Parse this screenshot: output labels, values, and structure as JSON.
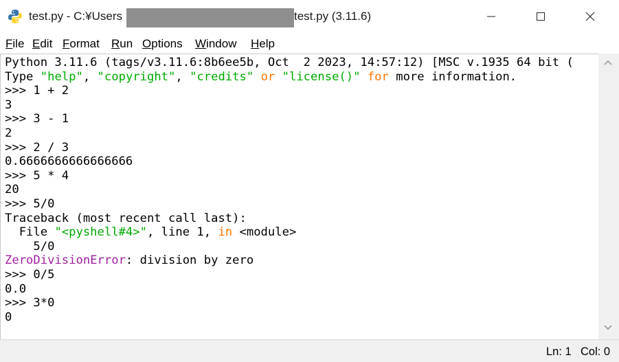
{
  "window": {
    "title_prefix": "test.py - C:¥Users",
    "title_suffix": "test.py (3.11.6)",
    "app_icon": "python-icon",
    "controls": {
      "minimize_icon": "minimize-icon",
      "maximize_icon": "maximize-icon",
      "close_icon": "close-icon"
    }
  },
  "menu": [
    {
      "label": "File"
    },
    {
      "label": "Edit"
    },
    {
      "label": "Format"
    },
    {
      "label": "Run"
    },
    {
      "label": "Options"
    },
    {
      "label": "Window"
    },
    {
      "label": "Help"
    }
  ],
  "colors": {
    "default": "#000000",
    "string": "#00aa00",
    "keyword": "#ff7700",
    "error": "#a020a0"
  },
  "shell_lines": [
    [
      {
        "t": "Python 3.11.6 (tags/v3.11.6:8b6ee5b, Oct  2 2023, 14:57:12) [MSC v.1935 64 bit (",
        "c": "default"
      }
    ],
    [
      {
        "t": "Type ",
        "c": "default"
      },
      {
        "t": "\"help\"",
        "c": "string"
      },
      {
        "t": ", ",
        "c": "default"
      },
      {
        "t": "\"copyright\"",
        "c": "string"
      },
      {
        "t": ", ",
        "c": "default"
      },
      {
        "t": "\"credits\"",
        "c": "string"
      },
      {
        "t": " ",
        "c": "default"
      },
      {
        "t": "or",
        "c": "keyword"
      },
      {
        "t": " ",
        "c": "default"
      },
      {
        "t": "\"license()\"",
        "c": "string"
      },
      {
        "t": " ",
        "c": "default"
      },
      {
        "t": "for",
        "c": "keyword"
      },
      {
        "t": " more information.",
        "c": "default"
      }
    ],
    [
      {
        "t": ">>> 1 + 2",
        "c": "default"
      }
    ],
    [
      {
        "t": "3",
        "c": "default"
      }
    ],
    [
      {
        "t": ">>> 3 - 1",
        "c": "default"
      }
    ],
    [
      {
        "t": "2",
        "c": "default"
      }
    ],
    [
      {
        "t": ">>> 2 / 3",
        "c": "default"
      }
    ],
    [
      {
        "t": "0.6666666666666666",
        "c": "default"
      }
    ],
    [
      {
        "t": ">>> 5 * 4",
        "c": "default"
      }
    ],
    [
      {
        "t": "20",
        "c": "default"
      }
    ],
    [
      {
        "t": ">>> 5/0",
        "c": "default"
      }
    ],
    [
      {
        "t": "Traceback (most recent call last):",
        "c": "default"
      }
    ],
    [
      {
        "t": "  File ",
        "c": "default"
      },
      {
        "t": "\"<pyshell#4>\"",
        "c": "string"
      },
      {
        "t": ", line 1, ",
        "c": "default"
      },
      {
        "t": "in",
        "c": "keyword"
      },
      {
        "t": " <module>",
        "c": "default"
      }
    ],
    [
      {
        "t": "    5/0",
        "c": "default"
      }
    ],
    [
      {
        "t": "ZeroDivisionError",
        "c": "error"
      },
      {
        "t": ": division by zero",
        "c": "default"
      }
    ],
    [
      {
        "t": ">>> 0/5",
        "c": "default"
      }
    ],
    [
      {
        "t": "0.0",
        "c": "default"
      }
    ],
    [
      {
        "t": ">>> 3*0",
        "c": "default"
      }
    ],
    [
      {
        "t": "0",
        "c": "default"
      }
    ]
  ],
  "scrollbar": {
    "up_icon": "scroll-up-arrow-icon",
    "down_icon": "scroll-down-arrow-icon"
  },
  "status": {
    "line": "Ln: 1",
    "col": "Col: 0"
  }
}
